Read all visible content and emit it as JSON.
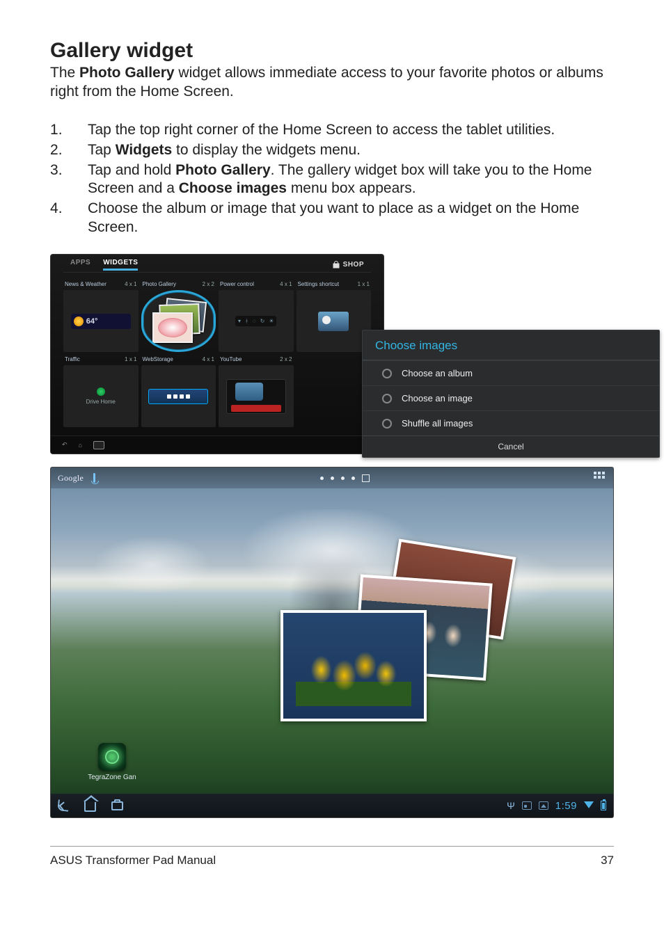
{
  "doc": {
    "heading": "Gallery widget",
    "intro_pre": "The ",
    "intro_bold": "Photo Gallery",
    "intro_post": " widget allows immediate access to your favorite photos or albums right from the Home Screen.",
    "steps": {
      "s1": "Tap the top right corner of the Home Screen to access the tablet utilities.",
      "s2_pre": "Tap ",
      "s2_bold": "Widgets",
      "s2_post": " to display the widgets menu.",
      "s3_pre": "Tap and hold ",
      "s3_bold1": "Photo Gallery",
      "s3_mid": ". The gallery widget box will take you to the Home Screen and a ",
      "s3_bold2": "Choose images",
      "s3_post": " menu box appears.",
      "s4": "Choose the album or image that you want to place as a widget on the Home Screen."
    },
    "footer_left": "ASUS Transformer Pad Manual",
    "footer_right": "37"
  },
  "widgets_panel": {
    "tab_apps": "APPS",
    "tab_widgets": "WIDGETS",
    "shop": "SHOP",
    "cells": {
      "news_weather": {
        "name": "News & Weather",
        "size": "4 x 1",
        "temp": "64°"
      },
      "photo_gallery": {
        "name": "Photo Gallery",
        "size": "2 x 2"
      },
      "power_control": {
        "name": "Power control",
        "size": "4 x 1"
      },
      "settings_shortcut": {
        "name": "Settings shortcut",
        "size": "1 x 1"
      },
      "traffic": {
        "name": "Traffic",
        "size": "1 x 1",
        "sub": "Drive Home"
      },
      "webstorage": {
        "name": "WebStorage",
        "size": "4 x 1"
      },
      "youtube": {
        "name": "YouTube",
        "size": "2 x 2"
      }
    }
  },
  "choose_menu": {
    "title": "Choose images",
    "opt_album": "Choose an album",
    "opt_image": "Choose an image",
    "opt_shuffle": "Shuffle all images",
    "cancel": "Cancel"
  },
  "home": {
    "search": "Google",
    "tegra_label": "TegraZone Gan",
    "clock": "1:59"
  }
}
